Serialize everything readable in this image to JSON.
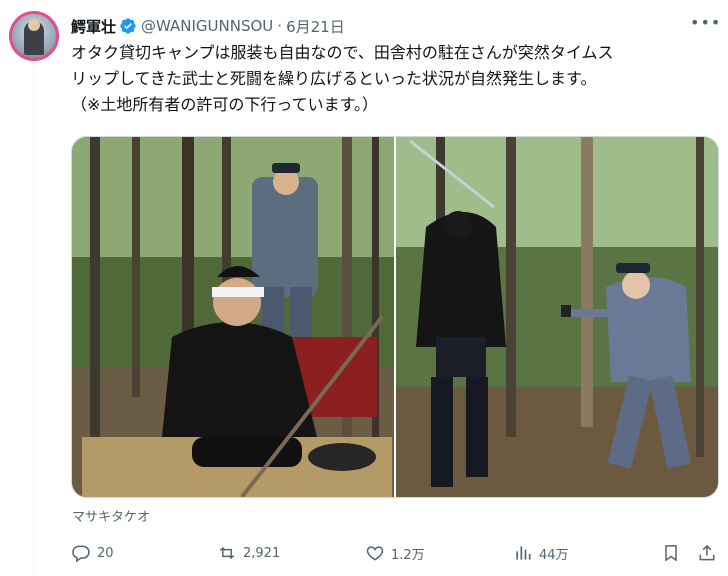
{
  "author": {
    "display_name": "鰐軍壮",
    "handle": "@WANIGUNNSOU",
    "separator": "·",
    "date": "6月21日",
    "verified_icon": "verified-badge-icon",
    "avatar_icon": "avatar"
  },
  "tweet": {
    "lines": [
      "オタク貸切キャンプは服装も自由なので、田舎村の駐在さんが突然タイムス",
      "リップしてきた武士と死闘を繰り広げるといった状況が自然発生します。",
      "（※土地所有者の許可の下行っています。）"
    ]
  },
  "media": {
    "credit": "マサキタケオ"
  },
  "actions": {
    "reply_count": "20",
    "retweet_count": "2,921",
    "like_count": "1.2万",
    "view_count": "44万",
    "icons": [
      "reply-icon",
      "retweet-icon",
      "like-icon",
      "views-icon",
      "bookmark-icon",
      "share-icon"
    ]
  },
  "colors": {
    "text_primary": "#0f1419",
    "text_secondary": "#536471",
    "verified_blue": "#1d9bf0",
    "border": "#cfd9de"
  }
}
